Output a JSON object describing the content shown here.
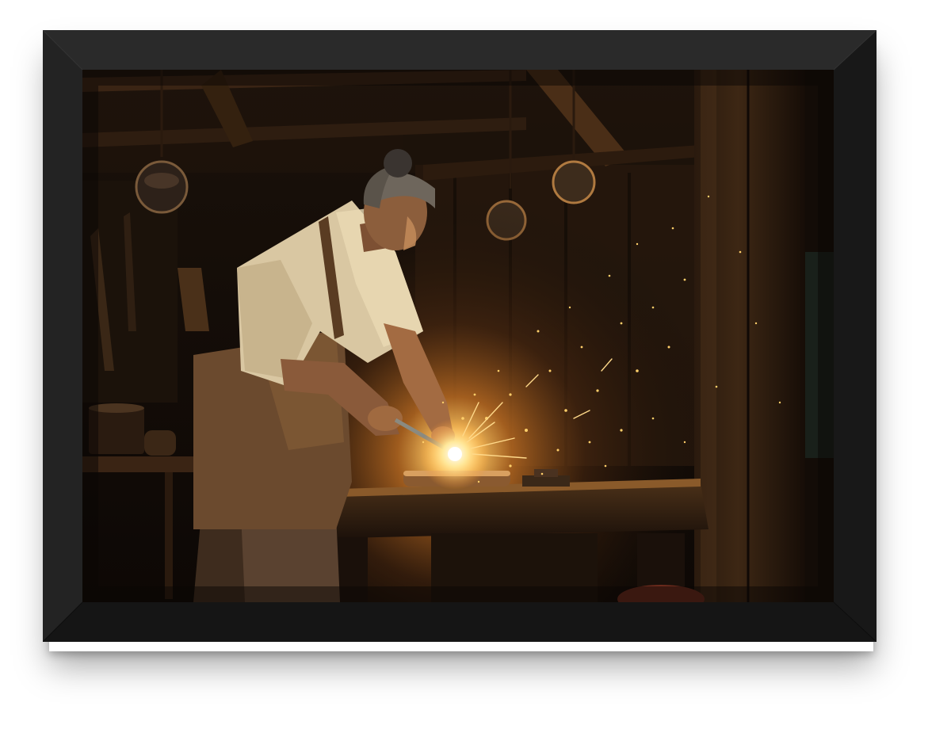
{
  "artwork": {
    "subject": "blacksmith-at-forge",
    "palette": {
      "frame": "#1c1c1c",
      "background": "#120c07",
      "glow": "#ffd27a",
      "ember": "#ff9a2a",
      "wood": "#3a2414",
      "apron": "#6b4a2e",
      "shirt": "#d9c7a2",
      "skin": "#8a5a3a"
    }
  }
}
